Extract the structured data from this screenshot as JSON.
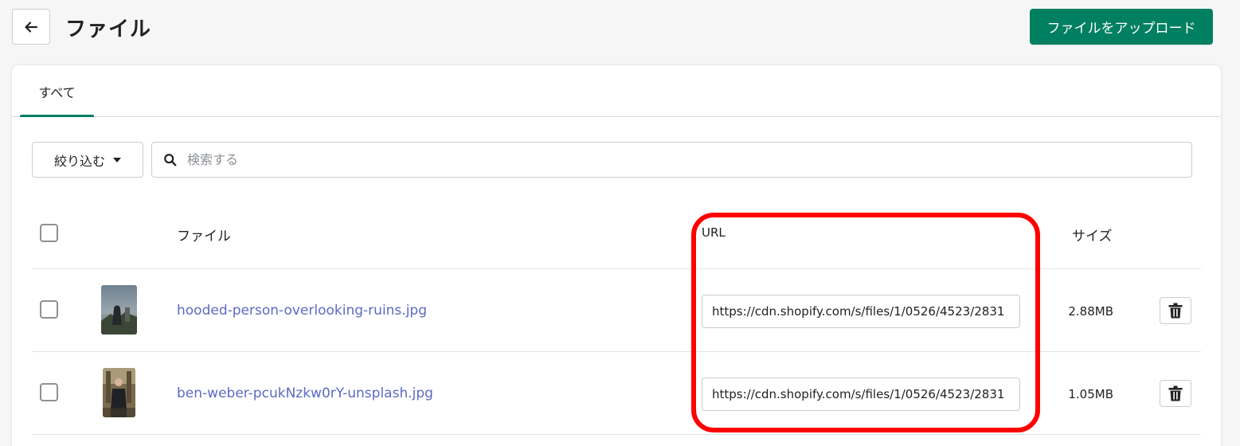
{
  "header": {
    "title": "ファイル",
    "upload_label": "ファイルをアップロード"
  },
  "tabs": [
    {
      "label": "すべて",
      "active": true
    }
  ],
  "toolbar": {
    "filter_label": "絞り込む",
    "search_placeholder": "検索する"
  },
  "table": {
    "columns": {
      "file": "ファイル",
      "url": "URL",
      "size": "サイズ"
    },
    "rows": [
      {
        "name": "hooded-person-overlooking-ruins.jpg",
        "url": "https://cdn.shopify.com/s/files/1/0526/4523/2831",
        "size": "2.88MB"
      },
      {
        "name": "ben-weber-pcukNzkw0rY-unsplash.jpg",
        "url": "https://cdn.shopify.com/s/files/1/0526/4523/2831",
        "size": "1.05MB"
      }
    ]
  },
  "colors": {
    "primary": "#008060",
    "link": "#5c6ac4",
    "highlight": "#ff0000"
  }
}
